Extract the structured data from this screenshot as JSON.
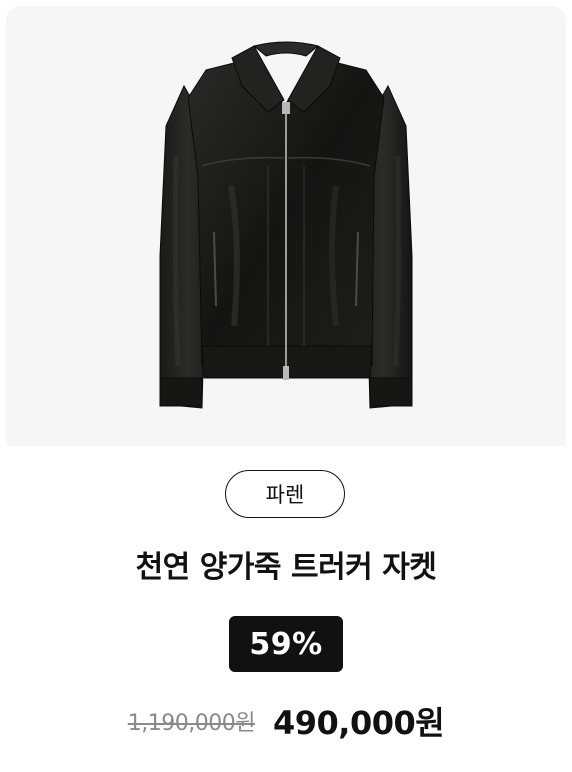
{
  "product": {
    "image_alt": "black-leather-jacket",
    "brand": "파렌",
    "name": "천연 양가죽 트러커 자켓",
    "discount": "59%",
    "original_price": "1,190,000원",
    "sale_price": "490,000원"
  },
  "colors": {
    "background": "#ffffff",
    "image_background": "#f6f6f6",
    "text": "#111111",
    "muted": "#8a8a8a",
    "badge_bg": "#111111",
    "badge_text": "#ffffff"
  }
}
